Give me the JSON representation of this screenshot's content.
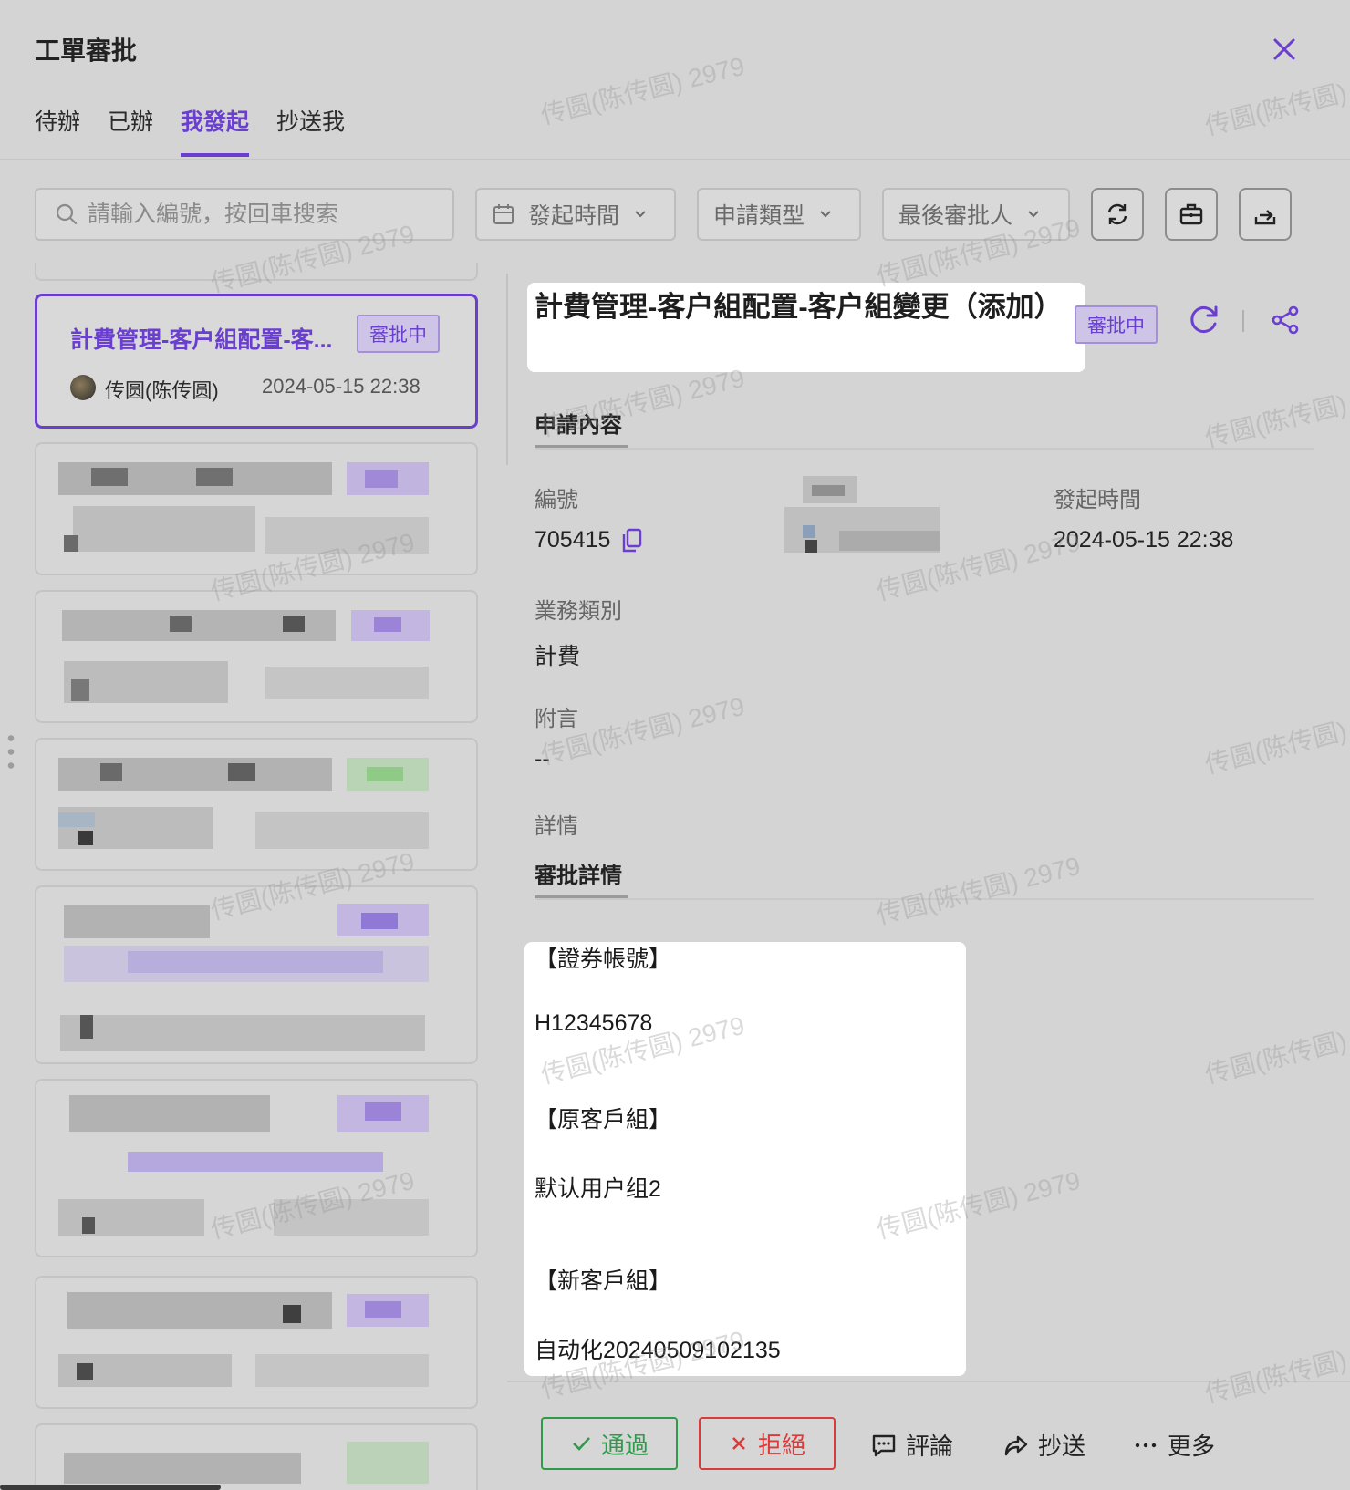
{
  "dialog": {
    "title": "工單審批"
  },
  "tabs": [
    {
      "label": "待辦"
    },
    {
      "label": "已辦"
    },
    {
      "label": "我發起"
    },
    {
      "label": "抄送我"
    }
  ],
  "active_tab": "我發起",
  "filters": {
    "search_placeholder": "請輸入編號，按回車搜索",
    "time": "發起時間",
    "type": "申請類型",
    "approver": "最後審批人"
  },
  "list": {
    "selected": {
      "title": "計費管理-客户組配置-客...",
      "status": "審批中",
      "user": "传圆(陈传圆)",
      "time": "2024-05-15 22:38"
    }
  },
  "detail": {
    "title": "計費管理-客户組配置-客户組變更（添加）",
    "status": "審批中",
    "section_content": "申請內容",
    "number_label": "編號",
    "number_value": "705415",
    "start_time_label": "發起時間",
    "start_time_value": "2024-05-15 22:38",
    "biz_label": "業務類別",
    "biz_value": "計費",
    "remark_label": "附言",
    "remark_value": "--",
    "detail_label": "詳情",
    "section_approval": "審批詳情",
    "body": {
      "account_label": "【證券帳號】",
      "account_value": "H12345678",
      "old_group_label": "【原客戶組】",
      "old_group_value": "默认用户组2",
      "new_group_label": "【新客戶組】",
      "new_group_value": "自动化20240509102135"
    }
  },
  "actions": {
    "approve": "通過",
    "reject": "拒絕",
    "comment": "評論",
    "cc": "抄送",
    "more": "更多"
  },
  "watermark": "传圆(陈传圆) 2979",
  "colors": {
    "accent": "#6a3fd0",
    "approve": "#2e9a4a",
    "reject": "#d93a3a"
  }
}
